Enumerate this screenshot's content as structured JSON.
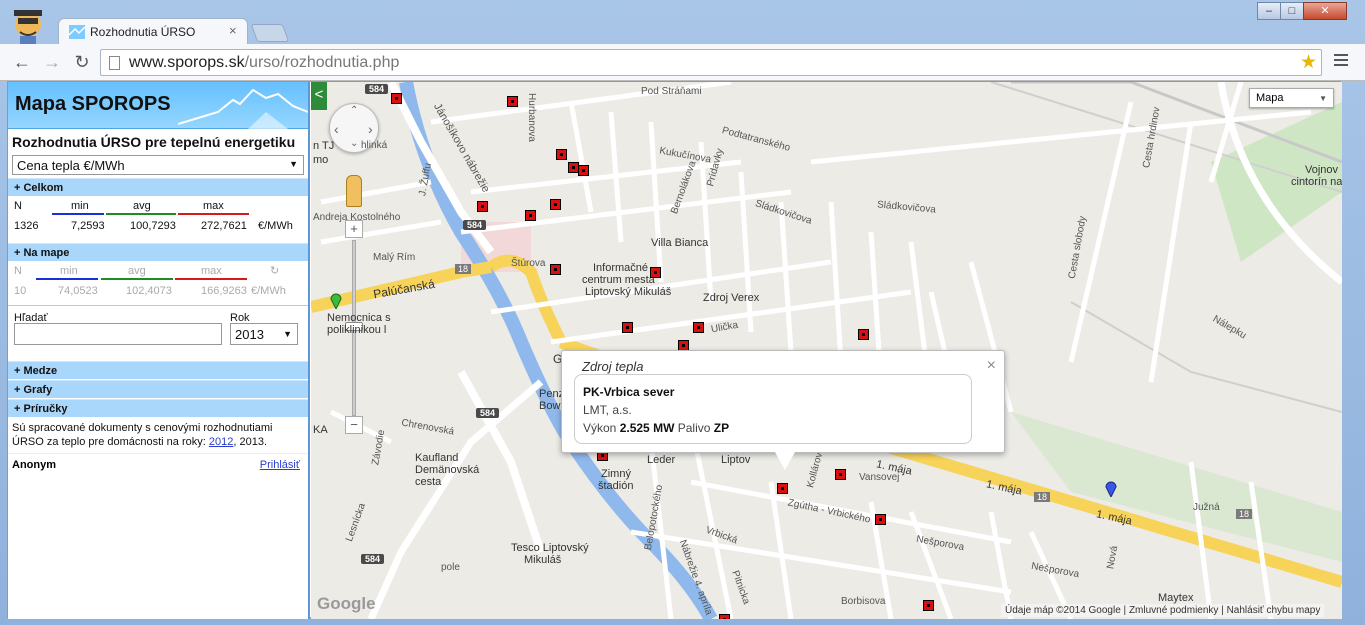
{
  "browser": {
    "tab_title": "Rozhodnutia ÚRSO",
    "tab_close": "×",
    "url_host": "www.sporops.sk",
    "url_path": "/urso/rozhodnutia.php",
    "window_buttons": [
      "–",
      "□",
      "✕"
    ],
    "nav": {
      "back": "←",
      "forward": "→",
      "reload": "↻"
    }
  },
  "sidebar": {
    "title": "Mapa SPOROPS",
    "subtitle": "Rozhodnutia ÚRSO pre tepelnú energetiku",
    "metric_select": "Cena tepla €/MWh",
    "sections": {
      "celkom": "+ Celkom",
      "na_mape": "+ Na mape",
      "medze": "+ Medze",
      "grafy": "+ Grafy",
      "prirucky": "+ Príručky"
    },
    "stat_headers": {
      "n": "N",
      "min": "min",
      "avg": "avg",
      "max": "max"
    },
    "celkom": {
      "n": "1326",
      "min": "7,2593",
      "avg": "100,7293",
      "max": "272,7621",
      "unit": "€/MWh"
    },
    "na_mape": {
      "n": "10",
      "min": "74,0523",
      "avg": "102,4073",
      "max": "166,9263",
      "unit": "€/MWh",
      "refresh": "↻"
    },
    "search": {
      "label": "Hľadať",
      "value": "",
      "year_label": "Rok",
      "year": "2013"
    },
    "note_text": "Sú spracované dokumenty s cenovými rozhodnutiami ÚRSO za teplo pre domácnosti na roky: ",
    "note_link": "2012",
    "note_rest": ", 2013.",
    "user": "Anonym",
    "login": "Prihlásiť",
    "colors": {
      "min": "#1b2fd6",
      "avg": "#1d8c24",
      "max": "#d41b1b",
      "header": "#7dcbff"
    }
  },
  "map": {
    "collapse": "<",
    "map_type": "Mapa",
    "pan": {
      "up": "⌃",
      "down": "⌄",
      "left": "‹",
      "right": "›"
    },
    "zoom_in": "+",
    "zoom_out": "−",
    "google": "Google",
    "attribution": "Údaje máp ©2014 Google",
    "terms": "Zmluvné podmienky",
    "report": "Nahlásiť chybu mapy",
    "labels": {
      "hurbanova": "Hurbanova",
      "podstranami": "Pod Stráňami",
      "podtatranskeho": "Podtatranského",
      "kukucinova": "Kukučínova",
      "bernolakova": "Bernolákova",
      "pridavky": "Prídavky",
      "villabianca": "Villa Bianca",
      "informacne": "Informačné",
      "centrum": "centrum mesta",
      "liptovsky": "Liptovský Mikuláš",
      "zdrojverex": "Zdroj Verex",
      "palucanska": "Palúčanská",
      "nemocnica": "Nemocnica s",
      "poliklinikou": "poliklinikou l",
      "janoskovo": "Jánošíkovo nábrežie",
      "stura": "Štúrova",
      "ulicka": "Ulička",
      "kostolneho": "Andreja Kostolného",
      "malyrim": "Malý Rím",
      "zuffu": "J. Žuffu",
      "sladkovicova": "Sládkovičova",
      "nalepku": "Nálepku",
      "chrenovska": "Chrenovská",
      "zadvorie": "Závodie",
      "kaufland": "Kaufland",
      "demanovska": "Demänovská",
      "cesta": "cesta",
      "zimny": "Zimný",
      "stadion": "štadión",
      "leder": "Leder",
      "liptov": "Liptov",
      "kollarova": "Kollárova",
      "vansovej": "Vansovej",
      "zgutha": "Zgútha - Vrbického",
      "nesporova": "Nešporova",
      "prvymaj1": "1. mája",
      "prvymaj2": "1. mája",
      "prvymaj3": "1. mája",
      "tesco": "Tesco Liptovský",
      "mikulas": "Mikuláš",
      "maytex": "Maytex",
      "juzna": "Južná",
      "nova": "Nová",
      "vojnovy": "Vojnov",
      "cintorin": "cintorín na",
      "cestahrdinov": "Cesta hrdinov",
      "cestaslobody": "Cesta slobody",
      "vrbicka": "Vrbická",
      "borbisova": "Borbisova",
      "pitnicka": "Pitnicka",
      "nabr4": "Nábrežie 4. apríla",
      "belopotockeho": "Belopotockého",
      "lesnicka": "Lesnícka",
      "penz": "Penz",
      "bowl": "Bowl",
      "road584a": "584",
      "road584b": "584",
      "road584c": "584",
      "road584d": "584",
      "road18a": "18",
      "road18b": "18",
      "road18c": "18",
      "gap": "Ga",
      "ka": "KA",
      "mo": "mo",
      "tj": "n TJ",
      "polioe": "pole",
      "hlinkova": "hlinká"
    },
    "popup": {
      "title": "Zdroj tepla",
      "close": "×",
      "name": "PK-Vrbica sever",
      "company": "LMT, a.s.",
      "vykon_label": "Výkon",
      "vykon_value": "2.525 MW",
      "palivo_label": "Palivo",
      "palivo_value": "ZP"
    }
  }
}
